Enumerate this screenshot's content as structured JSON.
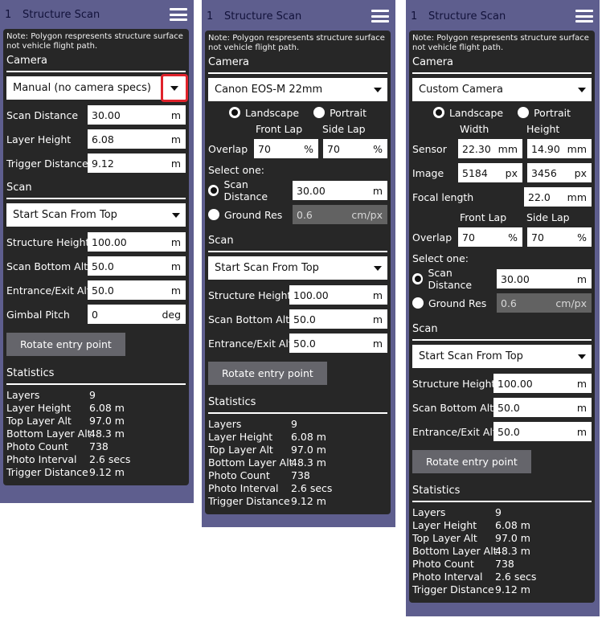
{
  "panels": [
    {
      "header": {
        "number": "1",
        "title": "Structure Scan"
      },
      "note": "Note: Polygon respresents structure surface not vehicle flight path.",
      "camera_section": "Camera",
      "camera_select": "Manual (no camera specs)",
      "camera_fields": [
        {
          "label": "Scan Distance",
          "value": "30.00",
          "unit": "m"
        },
        {
          "label": "Layer Height",
          "value": "6.08",
          "unit": "m"
        },
        {
          "label": "Trigger Distance",
          "value": "9.12",
          "unit": "m"
        }
      ],
      "scan_section": "Scan",
      "scan_select": "Start Scan From Top",
      "scan_fields": [
        {
          "label": "Structure Height",
          "value": "100.00",
          "unit": "m"
        },
        {
          "label": "Scan Bottom Alt",
          "value": "50.0",
          "unit": "m"
        },
        {
          "label": "Entrance/Exit Alt",
          "value": "50.0",
          "unit": "m"
        },
        {
          "label": "Gimbal Pitch",
          "value": "0",
          "unit": "deg"
        }
      ],
      "rotate_button": "Rotate entry point",
      "stats_section": "Statistics",
      "stats": [
        {
          "label": "Layers",
          "value": "9"
        },
        {
          "label": "Layer Height",
          "value": "6.08 m"
        },
        {
          "label": "Top Layer Alt",
          "value": "97.0 m"
        },
        {
          "label": "Bottom Layer Alt",
          "value": "48.3 m"
        },
        {
          "label": "Photo Count",
          "value": "738"
        },
        {
          "label": "Photo Interval",
          "value": "2.6 secs"
        },
        {
          "label": "Trigger Distance",
          "value": "9.12 m"
        }
      ]
    },
    {
      "header": {
        "number": "1",
        "title": "Structure Scan"
      },
      "note": "Note: Polygon respresents structure surface not vehicle flight path.",
      "camera_section": "Camera",
      "camera_select": "Canon EOS-M 22mm",
      "orientation": {
        "landscape": "Landscape",
        "portrait": "Portrait",
        "selected": "landscape"
      },
      "overlap": {
        "label": "Overlap",
        "front_header": "Front Lap",
        "side_header": "Side Lap",
        "front": "70",
        "side": "70",
        "unit": "%"
      },
      "select_one": "Select one:",
      "scan_distance": {
        "label": "Scan Distance",
        "value": "30.00",
        "unit": "m",
        "selected": true
      },
      "ground_res": {
        "label": "Ground Res",
        "value": "0.6",
        "unit": "cm/px",
        "selected": false
      },
      "scan_section": "Scan",
      "scan_select": "Start Scan From Top",
      "scan_fields": [
        {
          "label": "Structure Height",
          "value": "100.00",
          "unit": "m"
        },
        {
          "label": "Scan Bottom Alt",
          "value": "50.0",
          "unit": "m"
        },
        {
          "label": "Entrance/Exit Alt",
          "value": "50.0",
          "unit": "m"
        }
      ],
      "rotate_button": "Rotate entry point",
      "stats_section": "Statistics",
      "stats": [
        {
          "label": "Layers",
          "value": "9"
        },
        {
          "label": "Layer Height",
          "value": "6.08 m"
        },
        {
          "label": "Top Layer Alt",
          "value": "97.0 m"
        },
        {
          "label": "Bottom Layer Alt",
          "value": "48.3 m"
        },
        {
          "label": "Photo Count",
          "value": "738"
        },
        {
          "label": "Photo Interval",
          "value": "2.6 secs"
        },
        {
          "label": "Trigger Distance",
          "value": "9.12 m"
        }
      ]
    },
    {
      "header": {
        "number": "1",
        "title": "Structure Scan"
      },
      "note": "Note: Polygon respresents structure surface not vehicle flight path.",
      "camera_section": "Camera",
      "camera_select": "Custom Camera",
      "orientation": {
        "landscape": "Landscape",
        "portrait": "Portrait",
        "selected": "landscape"
      },
      "sensor_headers": {
        "width": "Width",
        "height": "Height"
      },
      "sensor": {
        "label": "Sensor",
        "width": "22.30",
        "height": "14.90",
        "unit": "mm"
      },
      "image": {
        "label": "Image",
        "width": "5184",
        "height": "3456",
        "unit": "px"
      },
      "focal": {
        "label": "Focal length",
        "value": "22.0",
        "unit": "mm"
      },
      "overlap": {
        "label": "Overlap",
        "front_header": "Front Lap",
        "side_header": "Side Lap",
        "front": "70",
        "side": "70",
        "unit": "%"
      },
      "select_one": "Select one:",
      "scan_distance": {
        "label": "Scan Distance",
        "value": "30.00",
        "unit": "m",
        "selected": true
      },
      "ground_res": {
        "label": "Ground Res",
        "value": "0.6",
        "unit": "cm/px",
        "selected": false
      },
      "scan_section": "Scan",
      "scan_select": "Start Scan From Top",
      "scan_fields": [
        {
          "label": "Structure Height",
          "value": "100.00",
          "unit": "m"
        },
        {
          "label": "Scan Bottom Alt",
          "value": "50.0",
          "unit": "m"
        },
        {
          "label": "Entrance/Exit Alt",
          "value": "50.0",
          "unit": "m"
        }
      ],
      "rotate_button": "Rotate entry point",
      "stats_section": "Statistics",
      "stats": [
        {
          "label": "Layers",
          "value": "9"
        },
        {
          "label": "Layer Height",
          "value": "6.08 m"
        },
        {
          "label": "Top Layer Alt",
          "value": "97.0 m"
        },
        {
          "label": "Bottom Layer Alt",
          "value": "48.3 m"
        },
        {
          "label": "Photo Count",
          "value": "738"
        },
        {
          "label": "Photo Interval",
          "value": "2.6 secs"
        },
        {
          "label": "Trigger Distance",
          "value": "9.12 m"
        }
      ]
    }
  ],
  "colors": {
    "header_bg": "#5e5e8e",
    "body_bg": "#272727",
    "highlight": "#e0222b",
    "button_bg": "#65656b",
    "disabled_field": "#626262"
  }
}
